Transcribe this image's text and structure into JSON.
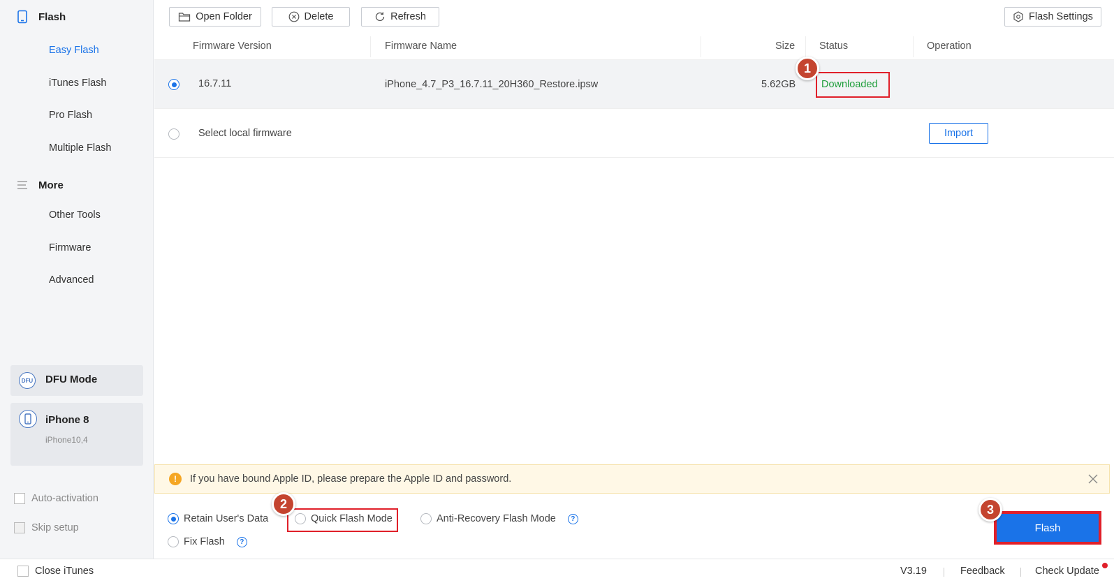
{
  "sidebar": {
    "flash_group_label": "Flash",
    "flash_items": [
      "Easy Flash",
      "iTunes Flash",
      "Pro Flash",
      "Multiple Flash"
    ],
    "more_group_label": "More",
    "more_items": [
      "Other Tools",
      "Firmware",
      "Advanced"
    ],
    "dfu_badge": "DFU",
    "dfu_label": "DFU Mode",
    "device_name": "iPhone 8",
    "device_model": "iPhone10,4",
    "auto_activation_label": "Auto-activation",
    "skip_setup_label": "Skip setup"
  },
  "toolbar": {
    "open_folder_label": "Open Folder",
    "delete_label": "Delete",
    "refresh_label": "Refresh",
    "flash_settings_label": "Flash Settings"
  },
  "table": {
    "headers": {
      "version": "Firmware Version",
      "name": "Firmware Name",
      "size": "Size",
      "status": "Status",
      "operation": "Operation"
    },
    "rows": [
      {
        "version": "16.7.11",
        "name": "iPhone_4.7_P3_16.7.11_20H360_Restore.ipsw",
        "size": "5.62GB",
        "status": "Downloaded",
        "selected": true
      }
    ],
    "local_label": "Select local firmware",
    "import_label": "Import"
  },
  "notice": {
    "text": "If you have bound Apple ID, please prepare the Apple ID and password."
  },
  "options": {
    "retain_label": "Retain User's Data",
    "quick_label": "Quick Flash Mode",
    "anti_recovery_label": "Anti-Recovery Flash Mode",
    "fix_label": "Fix Flash",
    "selected": "Retain User's Data"
  },
  "flash_button_label": "Flash",
  "markers": [
    "1",
    "2",
    "3"
  ],
  "footer": {
    "close_itunes_label": "Close iTunes",
    "version": "V3.19",
    "feedback_label": "Feedback",
    "check_update_label": "Check Update"
  },
  "colors": {
    "accent": "#1a73e8",
    "status_ok": "#1e9e3a",
    "highlight": "#e0202a",
    "marker": "#c4442f"
  }
}
